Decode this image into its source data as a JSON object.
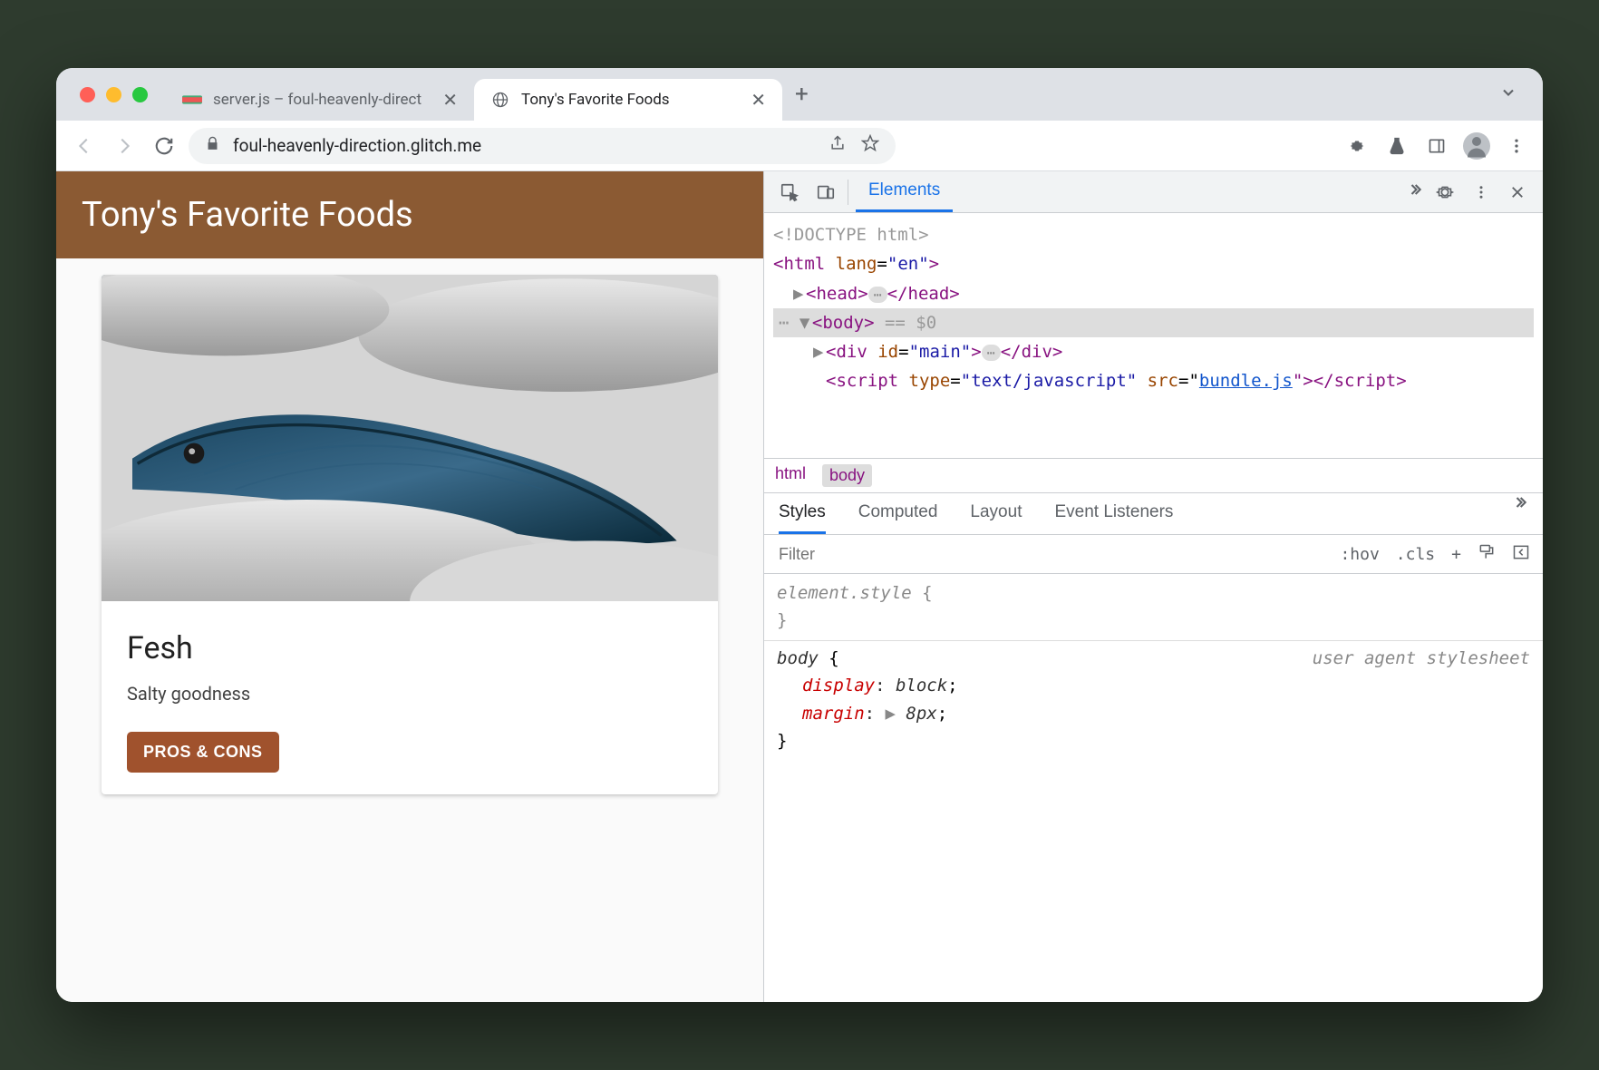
{
  "browser": {
    "tabs": [
      {
        "title": "server.js – foul-heavenly-direct",
        "active": false
      },
      {
        "title": "Tony's Favorite Foods",
        "active": true
      }
    ],
    "url_display": "foul-heavenly-direction.glitch.me"
  },
  "page": {
    "header": "Tony's Favorite Foods",
    "card": {
      "title": "Fesh",
      "subtitle": "Salty goodness",
      "button": "PROS & CONS"
    }
  },
  "devtools": {
    "top_tabs": {
      "active": "Elements"
    },
    "elements": {
      "l1": "<!DOCTYPE html>",
      "l2_open": "<html",
      "l2_attr": "lang",
      "l2_val": "\"en\"",
      "l2_close": ">",
      "l3_open": "<head>",
      "l3_close": "</head>",
      "l4": "<body>",
      "l4_suffix": " == $0",
      "l5_open": "<div",
      "l5_attr": "id",
      "l5_val": "\"main\"",
      "l5_mid": ">",
      "l5_close": "</div>",
      "l6_open": "<script",
      "l6_a1": "type",
      "l6_v1": "\"text/javascript\"",
      "l6_a2": "src",
      "l6_link": "bundle.js",
      "l6_mid": "\">",
      "l6_close": "</script>"
    },
    "breadcrumb": [
      "html",
      "body"
    ],
    "styles_tabs": [
      "Styles",
      "Computed",
      "Layout",
      "Event Listeners"
    ],
    "filter_placeholder": "Filter",
    "filter_controls": {
      "hov": ":hov",
      "cls": ".cls",
      "plus": "+"
    },
    "rules": {
      "r1_sel": "element.style",
      "r1_open": " {",
      "r1_close": "}",
      "r2_sel": "body",
      "r2_origin": "user agent stylesheet",
      "r2_open": " {",
      "r2_p1": "display",
      "r2_v1": "block",
      "r2_p2": "margin",
      "r2_v2": "8px",
      "r2_close": "}"
    }
  }
}
